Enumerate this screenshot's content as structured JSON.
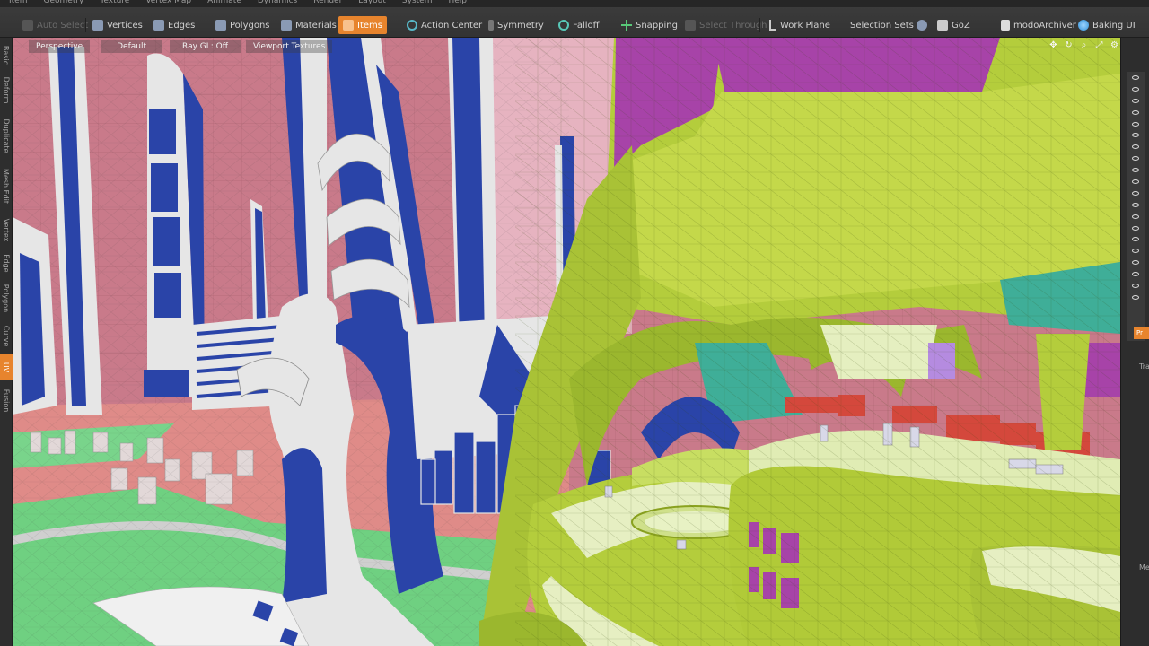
{
  "menu": [
    "Item",
    "Geometry",
    "Texture",
    "Vertex Map",
    "Animate",
    "Dynamics",
    "Render",
    "Layout",
    "System",
    "Help"
  ],
  "toolbar": {
    "auto_select": "Auto Select",
    "vertices": "Vertices",
    "edges": "Edges",
    "polygons": "Polygons",
    "materials": "Materials",
    "items": "Items",
    "action_center": "Action Center",
    "symmetry": "Symmetry",
    "falloff": "Falloff",
    "snapping": "Snapping",
    "select_through": "Select Through",
    "work_plane": "Work Plane",
    "selection_sets": "Selection Sets",
    "goz": "GoZ",
    "modo_archiver": "modoArchiver",
    "baking_ui": "Baking UI"
  },
  "left_tabs": [
    "Basic",
    "Deform",
    "Duplicate",
    "Mesh Edit",
    "Vertex",
    "Edge",
    "Polygon",
    "Curve",
    "UV",
    "Fusion"
  ],
  "active_left_tab": "UV",
  "viewport": {
    "view": "Perspective",
    "shading": "Default",
    "ray_gl": "Ray GL: Off",
    "textures": "Viewport Textures"
  },
  "right_panel": {
    "tab_label": "Pr",
    "label_1": "Tra",
    "label_2": "Me"
  },
  "colors": {
    "accent": "#e7842d",
    "sky": "#c97a8a",
    "tower_white": "#e6e6e6",
    "tower_blue": "#2a44a8",
    "structure_green": "#b4cd3c",
    "ground_green": "#6fd081",
    "purple": "#a743a8",
    "teal": "#3fae98",
    "red": "#d4483c"
  }
}
